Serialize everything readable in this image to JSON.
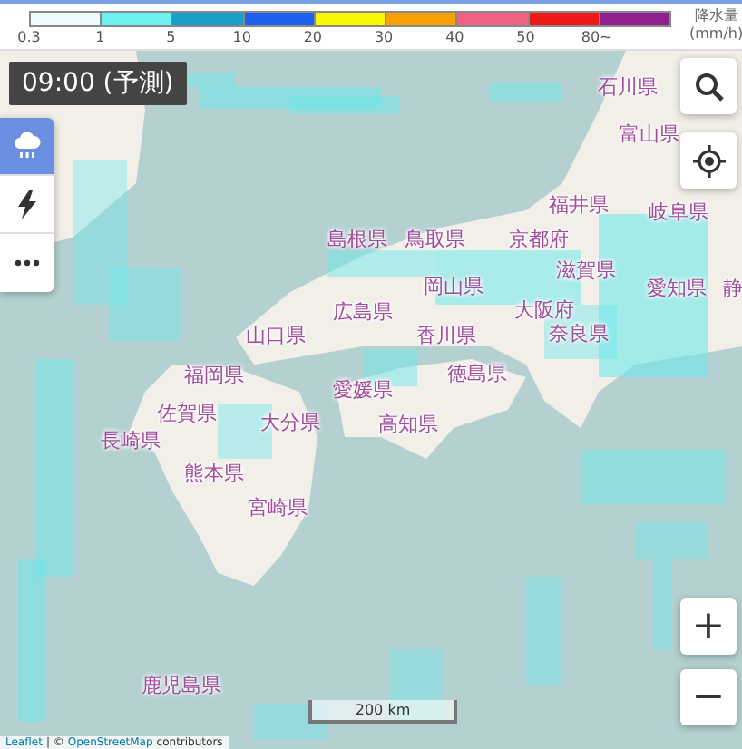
{
  "legend": {
    "segments": [
      {
        "color": "#f0fcfc"
      },
      {
        "color": "#6cf0f0"
      },
      {
        "color": "#1aa0c8"
      },
      {
        "color": "#2060f0"
      },
      {
        "color": "#f8f800"
      },
      {
        "color": "#f8a000"
      },
      {
        "color": "#f06080"
      },
      {
        "color": "#f01818"
      },
      {
        "color": "#902090"
      }
    ],
    "ticks": [
      "0.3",
      "1",
      "5",
      "10",
      "20",
      "30",
      "40",
      "50",
      "80~"
    ],
    "title": "降水量",
    "unit": "(mm/h)"
  },
  "time_badge": "09:00 (予測)",
  "layers": [
    {
      "kind": "rain",
      "selected": true
    },
    {
      "kind": "lightning",
      "selected": false
    },
    {
      "kind": "more",
      "selected": false
    }
  ],
  "places": [
    {
      "name": "石川県"
    },
    {
      "name": "富山県"
    },
    {
      "name": "福井県"
    },
    {
      "name": "岐阜県"
    },
    {
      "name": "島根県"
    },
    {
      "name": "鳥取県"
    },
    {
      "name": "京都府"
    },
    {
      "name": "滋賀県"
    },
    {
      "name": "岡山県"
    },
    {
      "name": "愛知県"
    },
    {
      "name": "静"
    },
    {
      "name": "広島県"
    },
    {
      "name": "大阪府"
    },
    {
      "name": "山口県"
    },
    {
      "name": "香川県"
    },
    {
      "name": "奈良県"
    },
    {
      "name": "福岡県"
    },
    {
      "name": "徳島県"
    },
    {
      "name": "愛媛県"
    },
    {
      "name": "佐賀県"
    },
    {
      "name": "大分県"
    },
    {
      "name": "高知県"
    },
    {
      "name": "長崎県"
    },
    {
      "name": "熊本県"
    },
    {
      "name": "宮崎県"
    },
    {
      "name": "鹿児島県"
    }
  ],
  "scale": "200 km",
  "zoom": {
    "in": "+",
    "out": "−"
  },
  "attribution": {
    "library": "Leaflet",
    "separator": "| ©",
    "source": "OpenStreetMap",
    "suffix": "contributors"
  }
}
